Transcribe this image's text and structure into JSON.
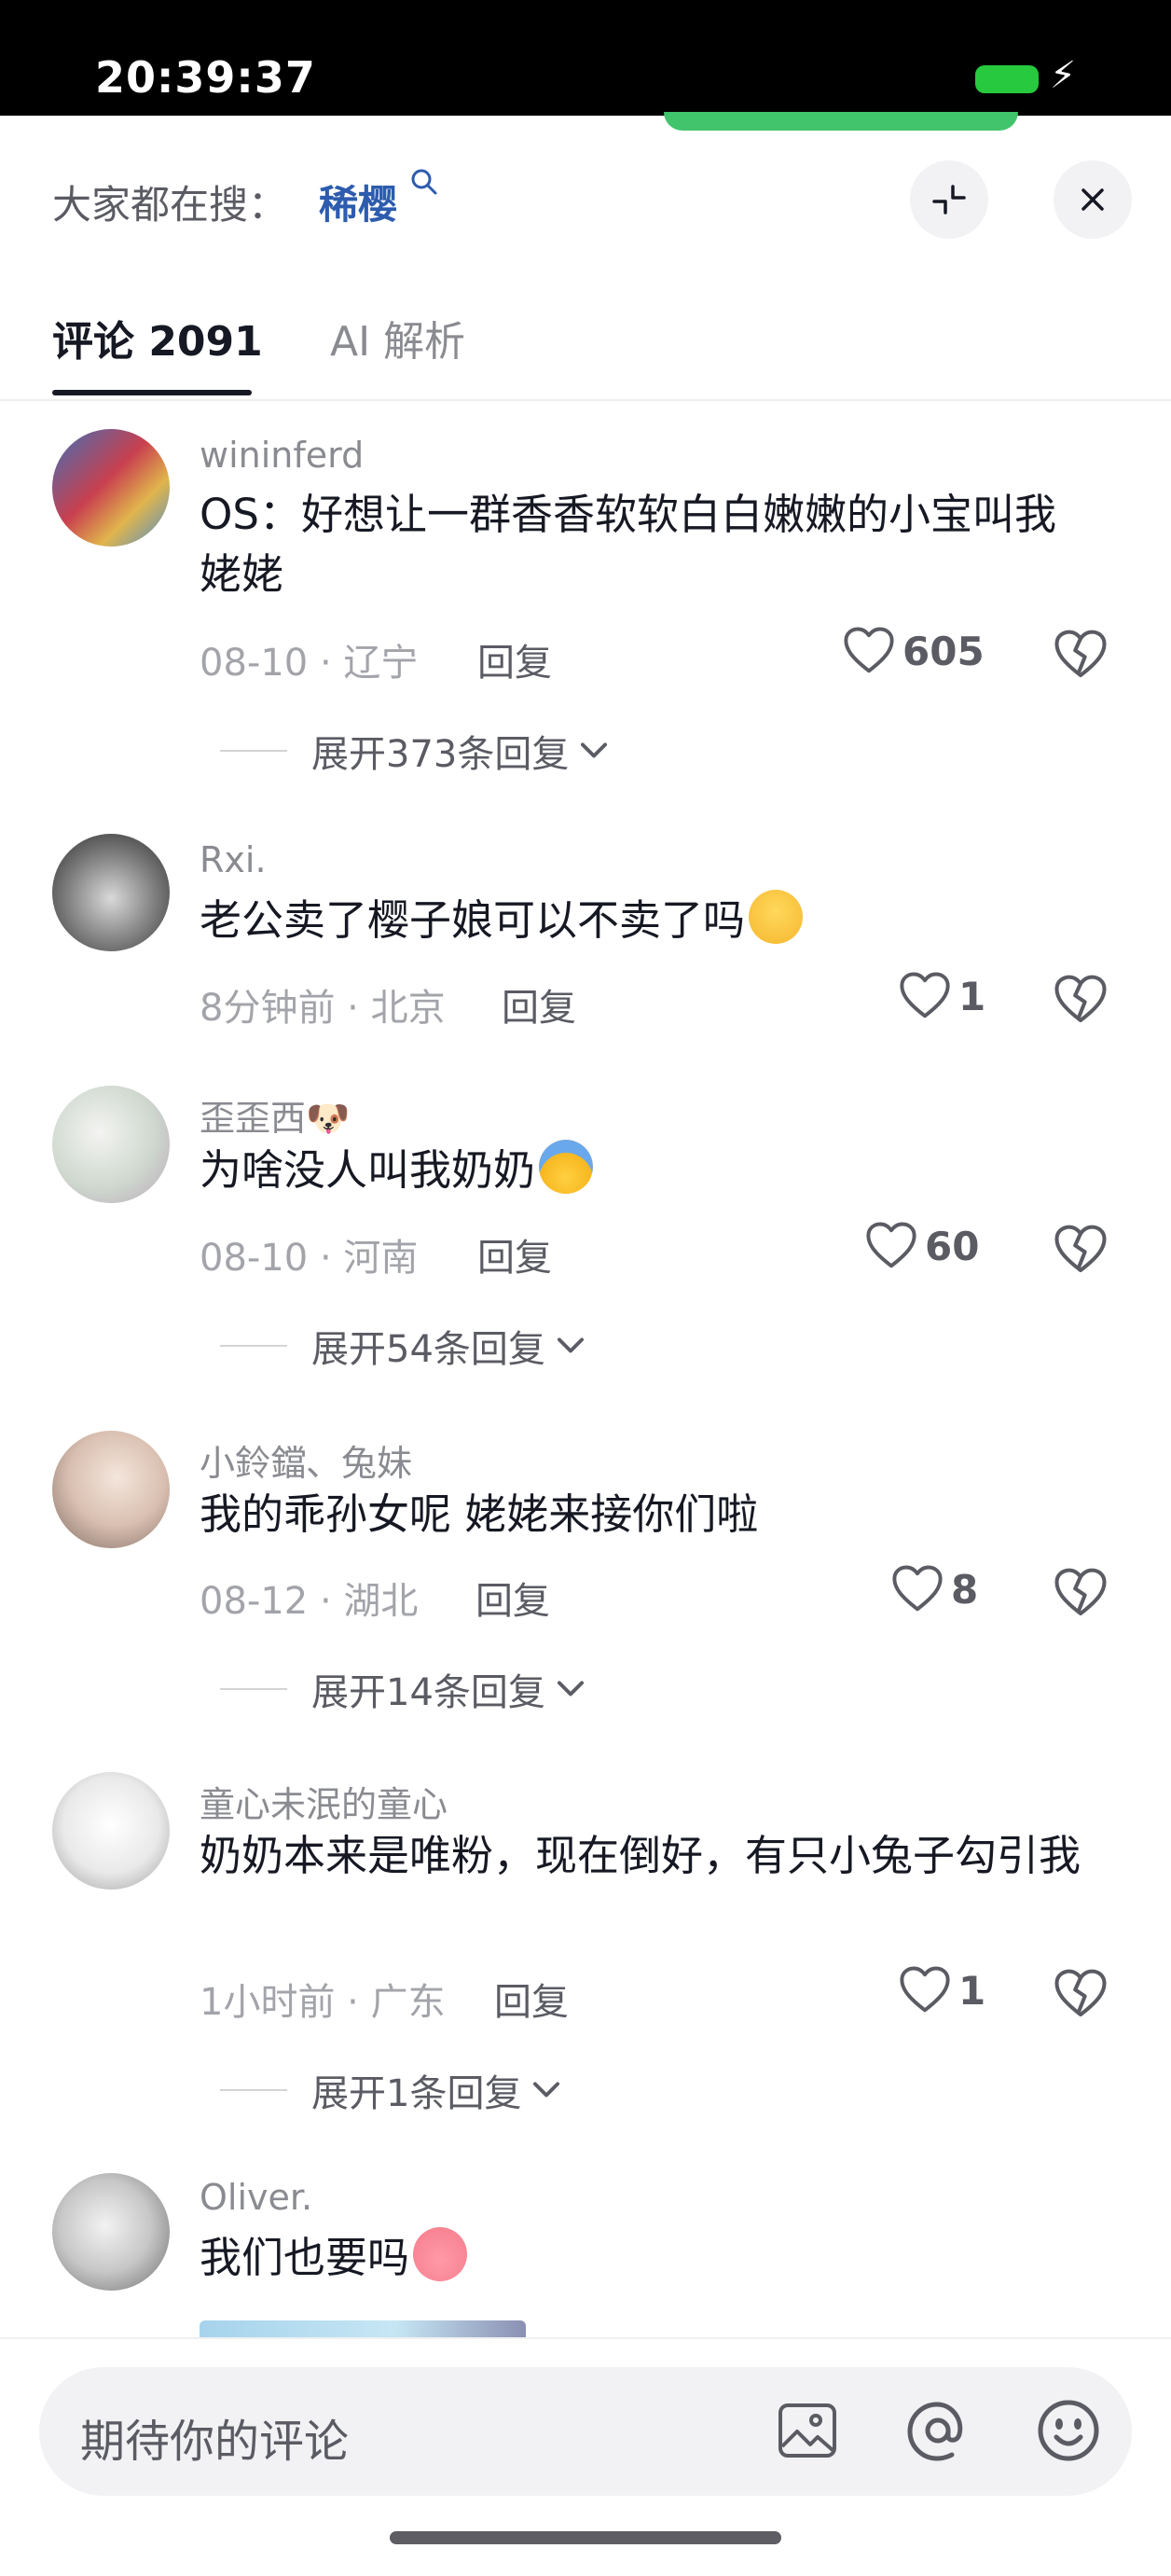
{
  "status_bar": {
    "time": "20:39:37"
  },
  "search": {
    "prefix": "大家都在搜：",
    "term": "稀樱"
  },
  "tabs": [
    {
      "label": "评论 2091"
    },
    {
      "label": "AI 解析"
    }
  ],
  "comments": [
    {
      "user": "wininferd",
      "text": "OS：好想让一群香香软软白白嫩嫩的小宝叫我姥姥",
      "meta": "08-10 · 辽宁",
      "reply": "回复",
      "likes": "605",
      "expand": "展开373条回复"
    },
    {
      "user": "Rxi.",
      "text": "老公卖了樱子娘可以不卖了吗",
      "emoji": "pleading-face",
      "meta": "8分钟前 · 北京",
      "reply": "回复",
      "likes": "1"
    },
    {
      "user": "歪歪西🐶",
      "text": "为啥没人叫我奶奶",
      "emoji": "crying-face",
      "meta": "08-10 · 河南",
      "reply": "回复",
      "likes": "60",
      "expand": "展开54条回复"
    },
    {
      "user": "小鈴鐺、兔妹",
      "text": "我的乖孙女呢 姥姥来接你们啦",
      "meta": "08-12 · 湖北",
      "reply": "回复",
      "likes": "8",
      "expand": "展开14条回复"
    },
    {
      "user": "童心未泯的童心",
      "text": "奶奶本来是唯粉，现在倒好，有只小兔子勾引我",
      "meta": "1小时前 · 广东",
      "reply": "回复",
      "likes": "1",
      "expand": "展开1条回复"
    },
    {
      "user": "Oliver.",
      "text": "我们也要吗",
      "emoji": "pig-face"
    }
  ],
  "input": {
    "placeholder": "期待你的评论"
  },
  "icons": {
    "search": "magnifier-icon",
    "collapse": "collapse-arrows-icon",
    "close": "close-icon",
    "like": "heart-icon",
    "dislike": "broken-heart-icon",
    "expand": "chevron-down-icon",
    "image": "image-icon",
    "mention": "at-icon",
    "emoji": "smiley-icon"
  },
  "colors": {
    "accent_link": "#2d5cae",
    "text_primary": "#161823",
    "text_secondary": "#8a8b91",
    "battery": "#27c93f"
  }
}
